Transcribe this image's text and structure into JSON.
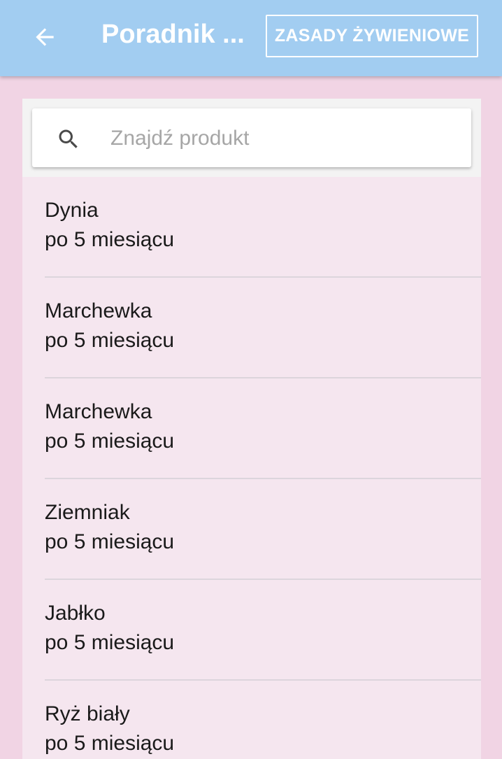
{
  "appbar": {
    "back_icon": "arrow-back-icon",
    "title": "Poradnik ...",
    "rules_button_label": "ZASADY ŻYWIENIOWE"
  },
  "search": {
    "icon": "search-icon",
    "placeholder": "Znajdź produkt",
    "value": ""
  },
  "products": [
    {
      "name": "Dynia",
      "age": "po 5 miesiącu"
    },
    {
      "name": "Marchewka",
      "age": "po 5 miesiącu"
    },
    {
      "name": "Marchewka",
      "age": "po 5 miesiącu"
    },
    {
      "name": "Ziemniak",
      "age": "po 5 miesiącu"
    },
    {
      "name": "Jabłko",
      "age": "po 5 miesiącu"
    },
    {
      "name": "Ryż biały",
      "age": "po 5 miesiącu"
    }
  ],
  "colors": {
    "appbar": "#a2cdf1",
    "background": "#f1d4e4",
    "list_background": "#f5e6ef"
  }
}
